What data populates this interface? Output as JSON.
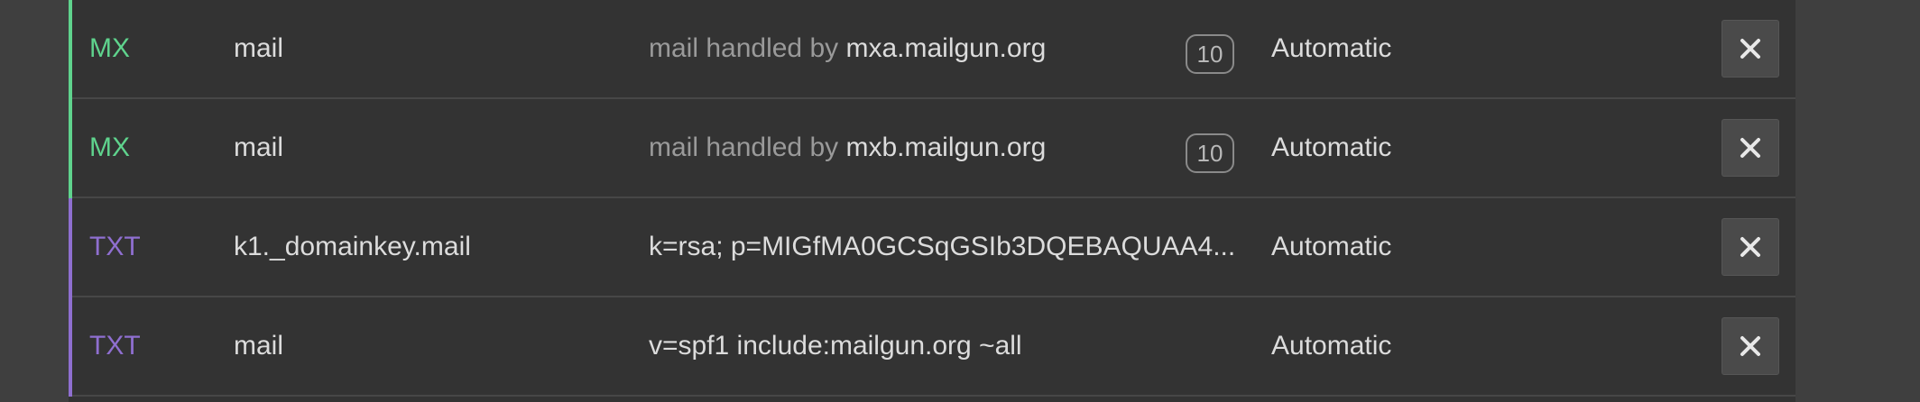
{
  "colors": {
    "mx": "#5fd38d",
    "txt": "#8f6fd0"
  },
  "records": [
    {
      "type": "MX",
      "name": "mail",
      "content_prefix": "mail handled by",
      "content": "mxa.mailgun.org",
      "priority": "10",
      "ttl": "Automatic",
      "delete_icon": "close-icon"
    },
    {
      "type": "MX",
      "name": "mail",
      "content_prefix": "mail handled by",
      "content": "mxb.mailgun.org",
      "priority": "10",
      "ttl": "Automatic",
      "delete_icon": "close-icon"
    },
    {
      "type": "TXT",
      "name": "k1._domainkey.mail",
      "content_prefix": "",
      "content": "k=rsa; p=MIGfMA0GCSqGSIb3DQEBAQUAA4...",
      "priority": "",
      "ttl": "Automatic",
      "delete_icon": "close-icon"
    },
    {
      "type": "TXT",
      "name": "mail",
      "content_prefix": "",
      "content": "v=spf1 include:mailgun.org ~all",
      "priority": "",
      "ttl": "Automatic",
      "delete_icon": "close-icon"
    }
  ]
}
